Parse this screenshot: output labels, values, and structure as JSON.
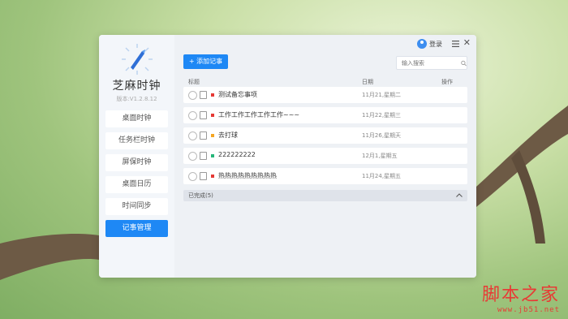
{
  "sidebar": {
    "app_name": "芝麻时钟",
    "version": "版本:V1.2.8.12",
    "items": [
      {
        "label": "桌面时钟",
        "active": false
      },
      {
        "label": "任务栏时钟",
        "active": false
      },
      {
        "label": "屏保时钟",
        "active": false
      },
      {
        "label": "桌面日历",
        "active": false
      },
      {
        "label": "时间同步",
        "active": false
      },
      {
        "label": "记事管理",
        "active": true
      }
    ]
  },
  "titlebar": {
    "login_label": "登录"
  },
  "toolbar": {
    "add_label": "+ 添加记事"
  },
  "search": {
    "placeholder": "输入搜索"
  },
  "table": {
    "headers": {
      "title": "标题",
      "date": "日期",
      "action": "操作"
    },
    "rows": [
      {
        "title": "测试备忘事项",
        "date": "11月21,星期二",
        "color": "#e53935"
      },
      {
        "title": "工作工作工作工作工作~~~",
        "date": "11月22,星期三",
        "color": "#e53935"
      },
      {
        "title": "去打球",
        "date": "11月26,星期天",
        "color": "#f5a623"
      },
      {
        "title": "222222222",
        "date": "12月1,星期五",
        "color": "#26b67a"
      },
      {
        "title": "热热热热热热热热热",
        "date": "11月24,星期五",
        "color": "#e53935"
      }
    ]
  },
  "completed": {
    "label": "已完成(5)"
  },
  "watermark": {
    "text": "脚本之家",
    "url": "www.jb51.net"
  },
  "colors": {
    "accent": "#1e88f5"
  }
}
